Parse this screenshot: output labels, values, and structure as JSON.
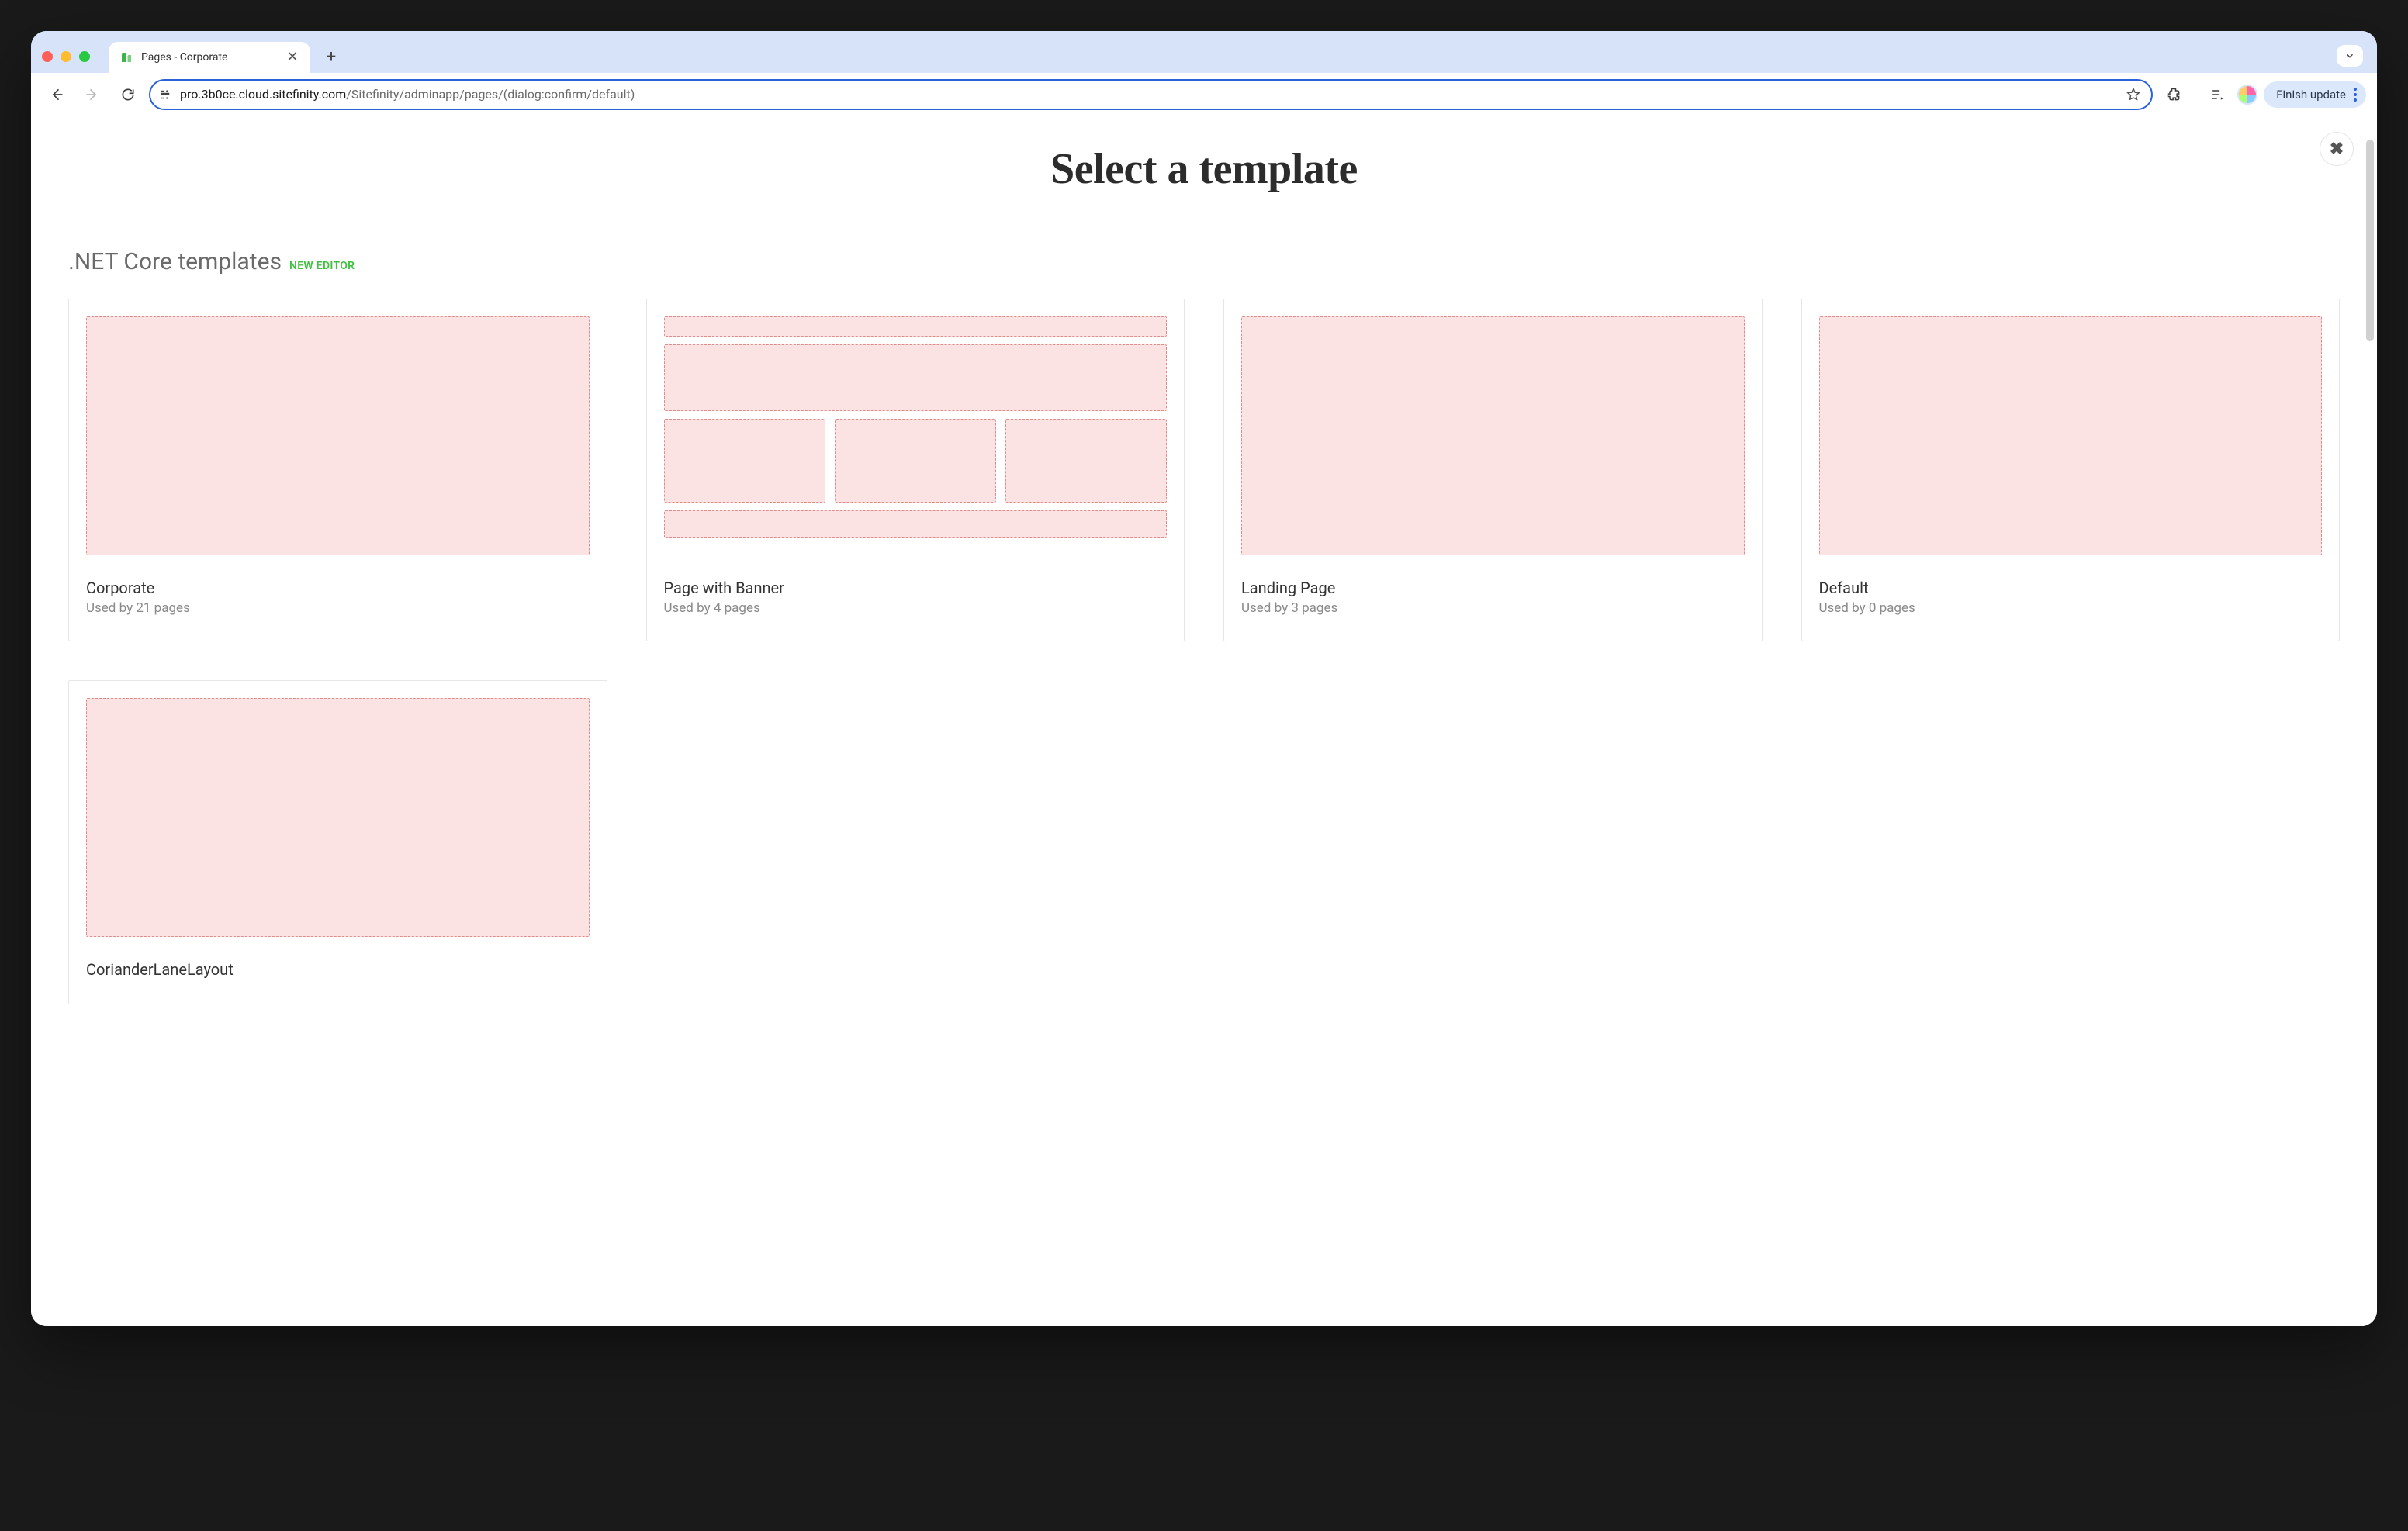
{
  "browser": {
    "tab_title": "Pages - Corporate",
    "url_host": "pro.3b0ce.cloud.sitefinity.com",
    "url_path": "/Sitefinity/adminapp/pages/(dialog:confirm/default)",
    "finish_update_label": "Finish update"
  },
  "dialog": {
    "title": "Select a template",
    "section_label": ".NET Core templates",
    "section_badge": "NEW EDITOR"
  },
  "templates": [
    {
      "name": "Corporate",
      "usage": "Used by 21 pages",
      "thumb": "full"
    },
    {
      "name": "Page with Banner",
      "usage": "Used by 4 pages",
      "thumb": "banner"
    },
    {
      "name": "Landing Page",
      "usage": "Used by 3 pages",
      "thumb": "full"
    },
    {
      "name": "Default",
      "usage": "Used by 0 pages",
      "thumb": "full"
    },
    {
      "name": "CorianderLaneLayout",
      "usage": "",
      "thumb": "full"
    }
  ]
}
